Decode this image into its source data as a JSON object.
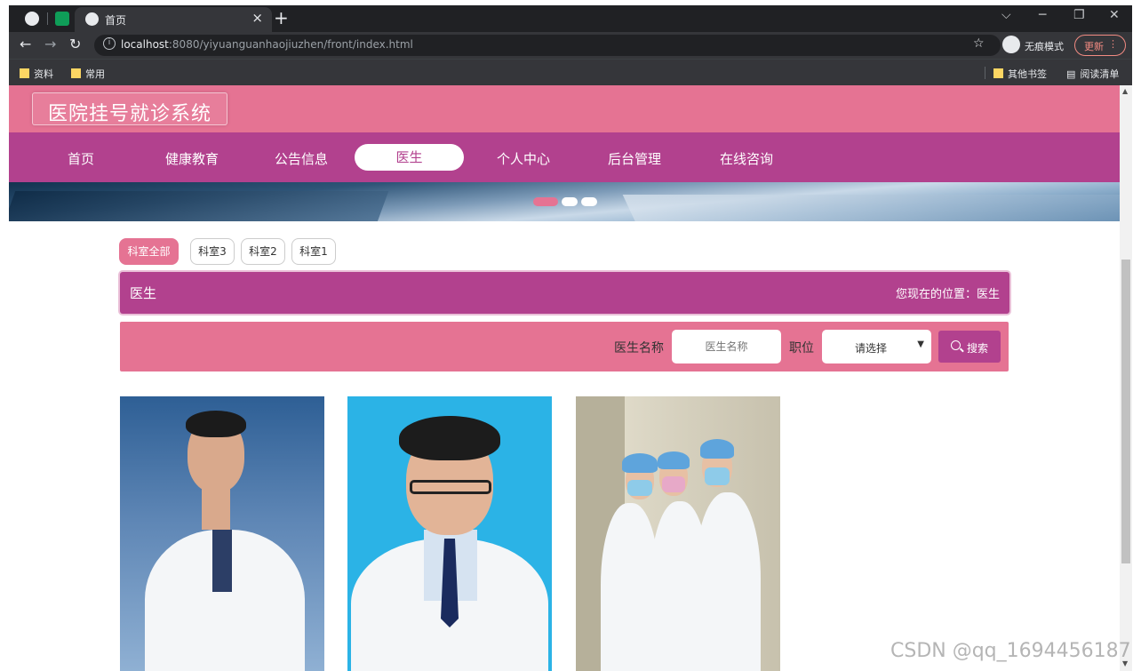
{
  "browser": {
    "tab_title": "首页",
    "new_tab": "+",
    "url_host": "localhost",
    "url_path": ":8080/yiyuanguanhaojiuzhen/front/index.html",
    "incognito_label": "无痕模式",
    "update_label": "更新",
    "bookmarks": [
      "资料",
      "常用"
    ],
    "bookmarks_right": [
      "其他书签",
      "阅读清单"
    ]
  },
  "site": {
    "title": "医院挂号就诊系统",
    "nav": [
      {
        "label": "首页"
      },
      {
        "label": "健康教育"
      },
      {
        "label": "公告信息"
      },
      {
        "label": "医生",
        "active": true
      },
      {
        "label": "个人中心"
      },
      {
        "label": "后台管理"
      },
      {
        "label": "在线咨询"
      }
    ],
    "carousel_dots": 3,
    "carousel_active": 0
  },
  "filters": [
    {
      "label": "科室全部",
      "active": true
    },
    {
      "label": "科室3"
    },
    {
      "label": "科室2"
    },
    {
      "label": "科室1"
    }
  ],
  "section": {
    "title": "医生",
    "breadcrumb": "您现在的位置：医生"
  },
  "search": {
    "name_label": "医生名称",
    "name_placeholder": "医生名称",
    "position_label": "职位",
    "position_selected": "请选择",
    "button_label": "搜索"
  },
  "doctors": [
    {
      "photo": "doctor-portrait-1"
    },
    {
      "photo": "doctor-portrait-2"
    },
    {
      "photo": "nurses-group-photo"
    }
  ],
  "watermark": "CSDN @qq_1694456187",
  "colors": {
    "header_pink": "#e57393",
    "nav_magenta": "#b2418e"
  }
}
